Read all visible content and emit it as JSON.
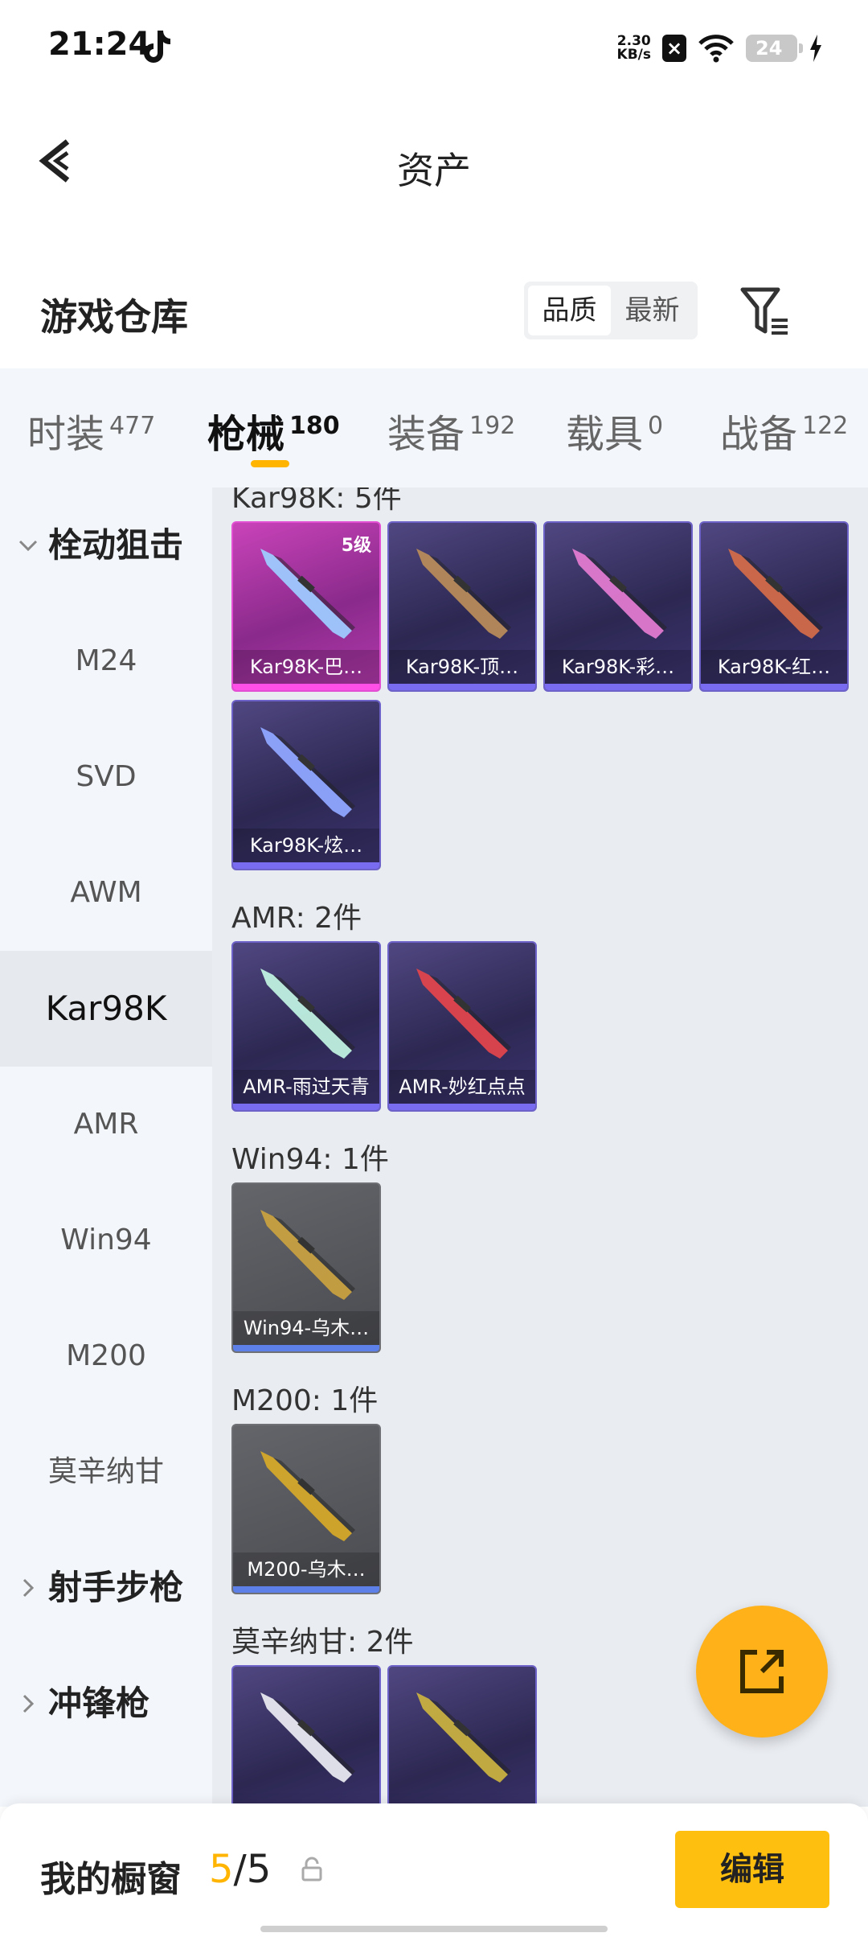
{
  "status_bar": {
    "time": "21:24",
    "net_speed_value": "2.30",
    "net_speed_unit": "KB/s",
    "battery": "24",
    "icons": [
      "tiktok-icon",
      "close-box-icon",
      "wifi-icon",
      "battery-icon",
      "charging-icon"
    ]
  },
  "header": {
    "title": "资产"
  },
  "warehouse": {
    "title": "游戏仓库",
    "sort_options": [
      "品质",
      "最新"
    ],
    "sort_selected": "品质"
  },
  "tabs": [
    {
      "label": "时装",
      "count": "477"
    },
    {
      "label": "枪械",
      "count": "180"
    },
    {
      "label": "装备",
      "count": "192"
    },
    {
      "label": "载具",
      "count": "0"
    },
    {
      "label": "战备",
      "count": "122"
    }
  ],
  "active_tab": "枪械",
  "sidebar": {
    "group_sniper": "栓动狙击",
    "items": [
      "M24",
      "SVD",
      "AWM",
      "Kar98K",
      "AMR",
      "Win94",
      "M200",
      "莫辛纳甘"
    ],
    "active_item": "Kar98K",
    "group_marksman": "射手步枪",
    "group_smg": "冲锋枪"
  },
  "sections": [
    {
      "label": "Kar98K: 5件",
      "items": [
        {
          "name": "Kar98K-巴…",
          "rarity": "pink",
          "level": "5级"
        },
        {
          "name": "Kar98K-顶…",
          "rarity": "purple"
        },
        {
          "name": "Kar98K-彩…",
          "rarity": "purple"
        },
        {
          "name": "Kar98K-红…",
          "rarity": "purple"
        },
        {
          "name": "Kar98K-炫…",
          "rarity": "purple"
        }
      ]
    },
    {
      "label": "AMR: 2件",
      "items": [
        {
          "name": "AMR-雨过天青",
          "rarity": "purple"
        },
        {
          "name": "AMR-妙红点点",
          "rarity": "purple"
        }
      ]
    },
    {
      "label": "Win94: 1件",
      "items": [
        {
          "name": "Win94-乌木…",
          "rarity": "grey"
        }
      ]
    },
    {
      "label": "M200: 1件",
      "items": [
        {
          "name": "M200-乌木…",
          "rarity": "grey"
        }
      ]
    },
    {
      "label": "莫辛纳甘: 2件",
      "items": [
        {
          "name": "",
          "rarity": "purple"
        },
        {
          "name": "",
          "rarity": "purple"
        }
      ]
    }
  ],
  "bottom_bar": {
    "label": "我的橱窗",
    "current": "5",
    "separator": "/",
    "total": "5",
    "edit_label": "编辑"
  },
  "colors": {
    "accent": "#ffb400",
    "purple_border": "#6d62c7",
    "pink_border": "#e24fd2"
  }
}
